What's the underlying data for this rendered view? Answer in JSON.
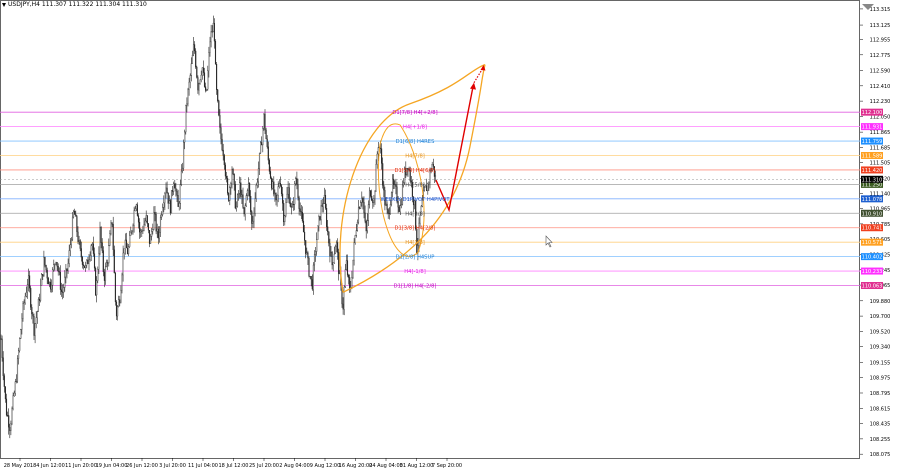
{
  "window": {
    "title": "USDJPY,H4  111.307 111.322 111.304 111.310"
  },
  "chart_data": {
    "type": "candlestick",
    "symbol": "USDJPY",
    "timeframe": "H4",
    "ohlc": {
      "open": "111.307",
      "high": "111.322",
      "low": "111.304",
      "close": "111.310"
    },
    "ylim": [
      108.03,
      113.42
    ],
    "price_ticks": [
      "113.315",
      "113.125",
      "112.955",
      "112.775",
      "112.590",
      "112.410",
      "112.230",
      "112.050",
      "111.865",
      "111.685",
      "111.505",
      "111.320",
      "111.140",
      "110.965",
      "110.785",
      "110.605",
      "110.425",
      "110.245",
      "110.065",
      "109.880",
      "109.700",
      "109.520",
      "109.340",
      "109.155",
      "108.975",
      "108.795",
      "108.615",
      "108.435",
      "108.255",
      "108.075"
    ],
    "date_ticks": [
      "28 May 2018",
      "4 Jun 12:00",
      "11 Jun 20:00",
      "19 Jun 04:00",
      "26 Jun 12:00",
      "3 Jul 20:00",
      "11 Jul 04:00",
      "18 Jul 12:00",
      "25 Jul 20:00",
      "2 Aug 04:00",
      "9 Aug 12:00",
      "16 Aug 20:00",
      "24 Aug 04:00",
      "31 Aug 12:00",
      "7 Sep 20:00"
    ],
    "price_path": [
      [
        0,
        109.6
      ],
      [
        6,
        108.6
      ],
      [
        10,
        108.4
      ],
      [
        16,
        108.95
      ],
      [
        22,
        109.7
      ],
      [
        28,
        110.15
      ],
      [
        34,
        109.55
      ],
      [
        38,
        109.8
      ],
      [
        44,
        110.35
      ],
      [
        50,
        110.05
      ],
      [
        56,
        110.4
      ],
      [
        62,
        109.95
      ],
      [
        68,
        110.3
      ],
      [
        74,
        110.95
      ],
      [
        80,
        110.45
      ],
      [
        86,
        110.25
      ],
      [
        92,
        110.6
      ],
      [
        96,
        109.95
      ],
      [
        100,
        110.7
      ],
      [
        104,
        110.15
      ],
      [
        108,
        110.4
      ],
      [
        112,
        110.85
      ],
      [
        116,
        109.7
      ],
      [
        120,
        109.95
      ],
      [
        124,
        110.55
      ],
      [
        128,
        110.45
      ],
      [
        132,
        110.75
      ],
      [
        136,
        111.1
      ],
      [
        140,
        110.65
      ],
      [
        146,
        110.85
      ],
      [
        150,
        110.55
      ],
      [
        154,
        110.9
      ],
      [
        158,
        110.6
      ],
      [
        162,
        111.0
      ],
      [
        166,
        111.25
      ],
      [
        170,
        110.95
      ],
      [
        174,
        111.35
      ],
      [
        178,
        110.95
      ],
      [
        182,
        111.4
      ],
      [
        186,
        112.15
      ],
      [
        190,
        112.5
      ],
      [
        194,
        112.9
      ],
      [
        198,
        112.4
      ],
      [
        202,
        112.65
      ],
      [
        206,
        112.25
      ],
      [
        210,
        112.95
      ],
      [
        214,
        113.15
      ],
      [
        216,
        112.4
      ],
      [
        220,
        111.85
      ],
      [
        224,
        111.6
      ],
      [
        228,
        111.05
      ],
      [
        232,
        111.45
      ],
      [
        236,
        110.95
      ],
      [
        240,
        111.25
      ],
      [
        244,
        110.85
      ],
      [
        248,
        111.3
      ],
      [
        252,
        110.75
      ],
      [
        256,
        111.2
      ],
      [
        260,
        111.6
      ],
      [
        264,
        112.05
      ],
      [
        268,
        111.55
      ],
      [
        272,
        111.25
      ],
      [
        276,
        111.0
      ],
      [
        280,
        111.35
      ],
      [
        284,
        110.85
      ],
      [
        288,
        111.2
      ],
      [
        292,
        110.9
      ],
      [
        296,
        111.35
      ],
      [
        300,
        110.95
      ],
      [
        304,
        110.65
      ],
      [
        308,
        110.3
      ],
      [
        312,
        110.05
      ],
      [
        316,
        110.55
      ],
      [
        320,
        110.9
      ],
      [
        324,
        111.1
      ],
      [
        328,
        110.65
      ],
      [
        332,
        110.3
      ],
      [
        336,
        110.6
      ],
      [
        340,
        110.1
      ],
      [
        343,
        109.8
      ],
      [
        346,
        110.35
      ],
      [
        350,
        109.95
      ],
      [
        354,
        110.5
      ],
      [
        358,
        110.95
      ],
      [
        362,
        111.15
      ],
      [
        366,
        110.65
      ],
      [
        370,
        111.2
      ],
      [
        374,
        111.05
      ],
      [
        378,
        111.75
      ],
      [
        381,
        111.6
      ],
      [
        384,
        111.1
      ],
      [
        388,
        110.85
      ],
      [
        392,
        111.25
      ],
      [
        396,
        111.15
      ],
      [
        400,
        110.95
      ],
      [
        404,
        111.35
      ],
      [
        408,
        111.5
      ],
      [
        412,
        111.2
      ],
      [
        415,
        110.95
      ],
      [
        417,
        110.45
      ],
      [
        420,
        110.85
      ],
      [
        424,
        111.15
      ],
      [
        428,
        111.25
      ],
      [
        432,
        111.5
      ],
      [
        436,
        111.3
      ]
    ],
    "forecast_arrow": {
      "from": [
        436,
        111.3
      ],
      "low": [
        449,
        110.95
      ],
      "to": [
        473,
        112.4
      ],
      "target": [
        483,
        112.62
      ]
    },
    "levels": [
      {
        "label": "D1[7/8] H4[+2/8]",
        "price": 112.1,
        "line_color": "#e060e0",
        "badge": "112.100",
        "badge_color": "#e03090",
        "text_color": "#c000c0"
      },
      {
        "label": "H4[+1/8]",
        "price": 111.93,
        "line_color": "#ff80ff",
        "badge": "111.931",
        "badge_color": "#ff30ff",
        "text_color": "#e020e0"
      },
      {
        "label": "D1[6/8] H4RES",
        "price": 111.76,
        "line_color": "#80c0ff",
        "badge": "111.759",
        "badge_color": "#1e90ff",
        "text_color": "#1e7fd0"
      },
      {
        "label": "H4[7/8]",
        "price": 111.59,
        "line_color": "#ffd080",
        "badge": "111.589",
        "badge_color": "#ffa020",
        "text_color": "#e09020"
      },
      {
        "label": "D1[5/8] H4[6/8]",
        "price": 111.42,
        "line_color": "#ff9080",
        "badge": "111.420",
        "badge_color": "#f04020",
        "text_color": "#e03010"
      },
      {
        "label": "H4[5/8]",
        "price": 111.25,
        "line_color": "#a0a0a0",
        "badge": "111.250",
        "badge_color": "#3a5a20",
        "text_color": "#404040"
      },
      {
        "label": "WEEKLY D1PIVOT H4PIVOT",
        "price": 111.08,
        "line_color": "#80b0ff",
        "badge": "111.078",
        "badge_color": "#1e60d0",
        "text_color": "#2050c0"
      },
      {
        "label": "H4[3/8]",
        "price": 110.91,
        "line_color": "#a0a0a0",
        "badge": "110.910",
        "badge_color": "#405030",
        "text_color": "#404040"
      },
      {
        "label": "D1[3/8] H4[2/8]",
        "price": 110.74,
        "line_color": "#ff9080",
        "badge": "110.741",
        "badge_color": "#f04020",
        "text_color": "#e03010"
      },
      {
        "label": "H4[1/8]",
        "price": 110.57,
        "line_color": "#ffd080",
        "badge": "110.571",
        "badge_color": "#ffa020",
        "text_color": "#e09020"
      },
      {
        "label": "D1[2/8] H4SUP",
        "price": 110.4,
        "line_color": "#80c0ff",
        "badge": "110.402",
        "badge_color": "#1e90ff",
        "text_color": "#1e7fd0"
      },
      {
        "label": "H4[-1/8]",
        "price": 110.23,
        "line_color": "#ff80ff",
        "badge": "110.233",
        "badge_color": "#ff30ff",
        "text_color": "#e020e0"
      },
      {
        "label": "D1[1/8] H4[-2/8]",
        "price": 110.06,
        "line_color": "#e060e0",
        "badge": "110.063",
        "badge_color": "#e03090",
        "text_color": "#c000c0"
      }
    ],
    "current_price": {
      "badge": "111.310",
      "badge_color": "#000000"
    },
    "colors": {
      "candles": "#222222",
      "grid": "#c8c8c8",
      "curve": "#f5a623",
      "arrow": "#e00000",
      "axis_text": "#000000"
    }
  }
}
